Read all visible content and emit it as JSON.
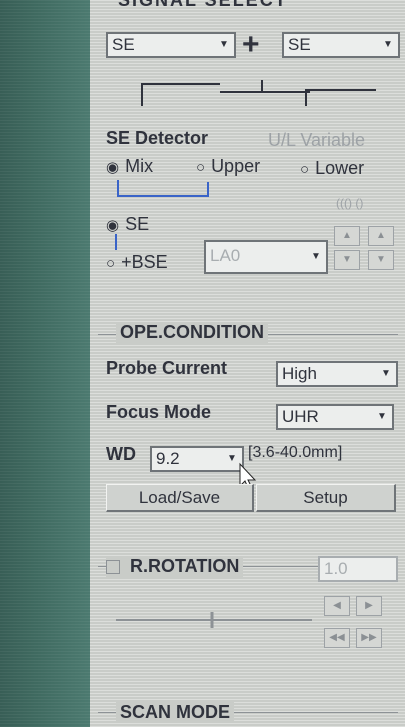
{
  "signal_select": {
    "title": "SIGNAL SELECT",
    "left_value": "SE",
    "right_value": "SE",
    "plus_symbol": "+"
  },
  "se_detector": {
    "title": "SE Detector",
    "ul_variable": "U/L Variable",
    "radio_mix": "Mix",
    "radio_upper": "Upper",
    "radio_lower": "Lower",
    "radio_se": "SE",
    "radio_bse": "+BSE",
    "bse_value": "LA0",
    "ring_label": "((() ()"
  },
  "ope_condition": {
    "title": "OPE.CONDITION",
    "probe_current_label": "Probe Current",
    "probe_current_value": "High",
    "focus_mode_label": "Focus Mode",
    "focus_mode_value": "UHR",
    "wd_label": "WD",
    "wd_value": "9.2",
    "wd_range": "[3.6-40.0mm]",
    "load_save_label": "Load/Save",
    "setup_label": "Setup"
  },
  "r_rotation": {
    "title": "R.ROTATION",
    "value": "1.0"
  },
  "scan_mode": {
    "title": "SCAN MODE"
  },
  "colors": {
    "panel_bg": "#c9ccc8",
    "outer_bg": "#3f6a60",
    "text": "#30333d",
    "disabled_text": "#9da2a6"
  }
}
